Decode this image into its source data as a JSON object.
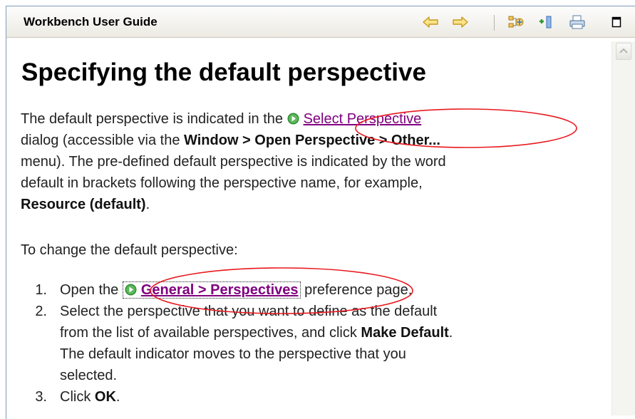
{
  "view": {
    "title": "Workbench User Guide",
    "toolbar": {
      "back_icon": "back-arrow-icon",
      "forward_icon": "forward-arrow-icon",
      "sync_icon": "show-in-contents-icon",
      "bookmark_icon": "bookmark-document-icon",
      "print_icon": "print-icon",
      "maximize_icon": "maximize-icon"
    }
  },
  "page": {
    "heading": "Specifying the default perspective",
    "para1": {
      "t1": "The default perspective is indicated in the",
      "link": "Select Perspective",
      "t2": "dialog (accessible via the",
      "menu_path": "Window > Open Perspective > Other...",
      "t3": "menu). The pre-defined default perspective is indicated by the word",
      "t4": "default in brackets following the perspective name, for example,",
      "example": "Resource (default)",
      "t5": "."
    },
    "para2": "To change the default perspective:",
    "steps": [
      {
        "num": "1.",
        "pre": "Open the",
        "link": "General > Perspectives",
        "post": "preference page."
      },
      {
        "num": "2.",
        "line1": "Select the perspective that you want to define as the default",
        "line2a": "from the list of available perspectives, and click",
        "bold": "Make Default",
        "line2b": ".",
        "line3": "The default indicator moves to the perspective that you",
        "line4": "selected."
      },
      {
        "num": "3.",
        "pre": "Click",
        "bold": "OK",
        "post": "."
      }
    ]
  },
  "colors": {
    "link": "#800080",
    "annotation": "#e8191f",
    "go_icon": "#2e8b2e"
  }
}
